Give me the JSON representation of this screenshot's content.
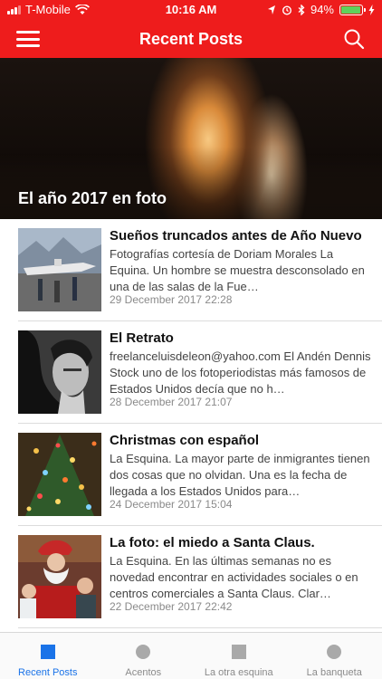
{
  "status_bar": {
    "carrier": "T-Mobile",
    "time": "10:16 AM",
    "battery": "94%",
    "battery_level": 0.94,
    "icons": [
      "signal-icon",
      "wifi-icon",
      "location-icon",
      "alarm-icon",
      "bluetooth-icon",
      "battery-icon",
      "charging-icon"
    ]
  },
  "nav": {
    "title": "Recent Posts",
    "menu_icon": "menu-icon",
    "search_icon": "search-icon"
  },
  "colors": {
    "brand_red": "#ee1c1c",
    "tab_active": "#1a73e8",
    "tab_inactive": "#8a8a8a"
  },
  "featured": {
    "title": "El año 2017 en foto"
  },
  "posts": [
    {
      "title": "Sueños truncados antes de Año Nuevo",
      "excerpt": "Fotografías cortesía de Doriam Morales  La Equina.  Un hombre se muestra desconsolado en una de las salas de la Fue…",
      "date": "29 December 2017 22:28"
    },
    {
      "title": "El Retrato",
      "excerpt": "freelanceluisdeleon@yahoo.com  El Andén Dennis Stock uno de los fotoperiodistas más famosos de Estados Unidos decía que no h…",
      "date": "28 December 2017 21:07"
    },
    {
      "title": "Christmas con español",
      "excerpt": "   La Esquina.  La mayor parte de inmigrantes tienen dos cosas que no olvidan. Una es la fecha de llegada a los Estados Unidos para…",
      "date": "24 December 2017 15:04"
    },
    {
      "title": "La foto: el miedo a Santa Claus.",
      "excerpt": "La Esquina.  En las últimas semanas no es novedad encontrar en actividades sociales o en centros comerciales a Santa Claus. Clar…",
      "date": "22 December 2017 22:42"
    }
  ],
  "tabs": [
    {
      "label": "Recent Posts",
      "icon": "square-icon",
      "active": true
    },
    {
      "label": "Acentos",
      "icon": "circle-icon",
      "active": false
    },
    {
      "label": "La otra esquina",
      "icon": "square-icon",
      "active": false
    },
    {
      "label": "La banqueta",
      "icon": "circle-icon",
      "active": false
    }
  ]
}
